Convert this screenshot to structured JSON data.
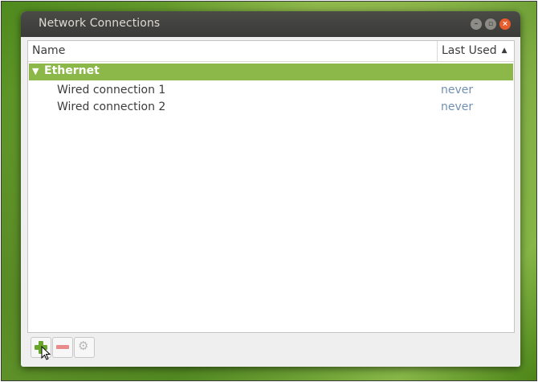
{
  "window": {
    "title": "Network Connections",
    "controls": {
      "minimize": "–",
      "maximize": "▫",
      "close": "×"
    }
  },
  "list": {
    "columns": {
      "name": "Name",
      "last_used": "Last Used",
      "sort_indicator": "▲"
    },
    "groups": [
      {
        "label": "Ethernet",
        "expander": "▼",
        "connections": [
          {
            "name": "Wired connection 1",
            "last_used": "never"
          },
          {
            "name": "Wired connection 2",
            "last_used": "never"
          }
        ]
      }
    ]
  },
  "toolbar": {
    "add_icon": "plus-icon",
    "remove_icon": "minus-icon",
    "settings_icon": "gear-icon",
    "settings_glyph": "⚙"
  },
  "colors": {
    "group_highlight": "#8cb84a",
    "accent_green": "#6aa52b",
    "close_button": "#e85d2b",
    "last_used_text": "#7290b0"
  }
}
